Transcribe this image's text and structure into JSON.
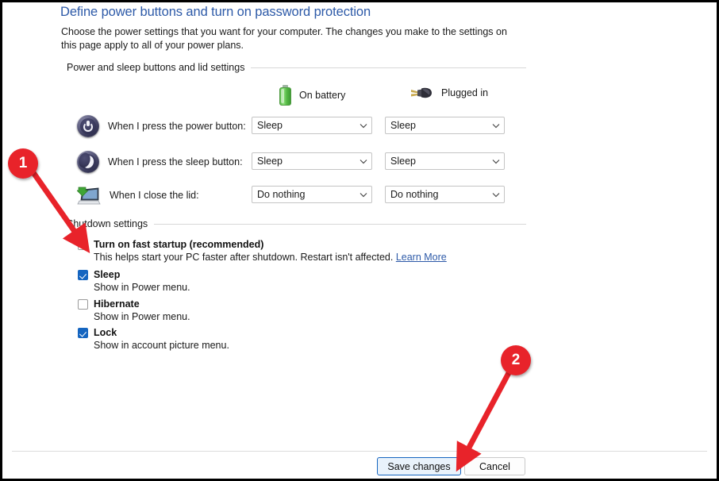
{
  "page": {
    "title": "Define power buttons and turn on password protection",
    "description": "Choose the power settings that you want for your computer. The changes you make to the settings on this page apply to all of your power plans."
  },
  "groups": {
    "power_sleep_lid": "Power and sleep buttons and lid settings",
    "shutdown": "Shutdown settings"
  },
  "columns": [
    {
      "label": "On battery",
      "icon": "battery-icon"
    },
    {
      "label": "Plugged in",
      "icon": "power-plug-icon"
    }
  ],
  "settings_rows": [
    {
      "icon": "power-button-icon",
      "label": "When I press the power button:",
      "on_battery": "Sleep",
      "plugged_in": "Sleep"
    },
    {
      "icon": "sleep-button-icon",
      "label": "When I press the sleep button:",
      "on_battery": "Sleep",
      "plugged_in": "Sleep"
    },
    {
      "icon": "laptop-lid-icon",
      "label": "When I close the lid:",
      "on_battery": "Do nothing",
      "plugged_in": "Do nothing"
    }
  ],
  "shutdown_options": [
    {
      "label": "Turn on fast startup (recommended)",
      "checked": false,
      "description": "This helps start your PC faster after shutdown. Restart isn't affected.",
      "link": "Learn More"
    },
    {
      "label": "Sleep",
      "checked": true,
      "description": "Show in Power menu.",
      "link": ""
    },
    {
      "label": "Hibernate",
      "checked": false,
      "description": "Show in Power menu.",
      "link": ""
    },
    {
      "label": "Lock",
      "checked": true,
      "description": "Show in account picture menu.",
      "link": ""
    }
  ],
  "footer": {
    "save_label": "Save changes",
    "cancel_label": "Cancel"
  },
  "annotations": [
    {
      "number": "1",
      "target": "fast-startup-checkbox"
    },
    {
      "number": "2",
      "target": "save-changes-button"
    }
  ],
  "colors": {
    "title_blue": "#2d5aa8",
    "link_blue": "#2d5aa8",
    "checkbox_checked": "#1565c0",
    "annotation_red": "#e8232a",
    "primary_button_border": "#1565c0"
  },
  "dropdown_glyph": "⌄"
}
